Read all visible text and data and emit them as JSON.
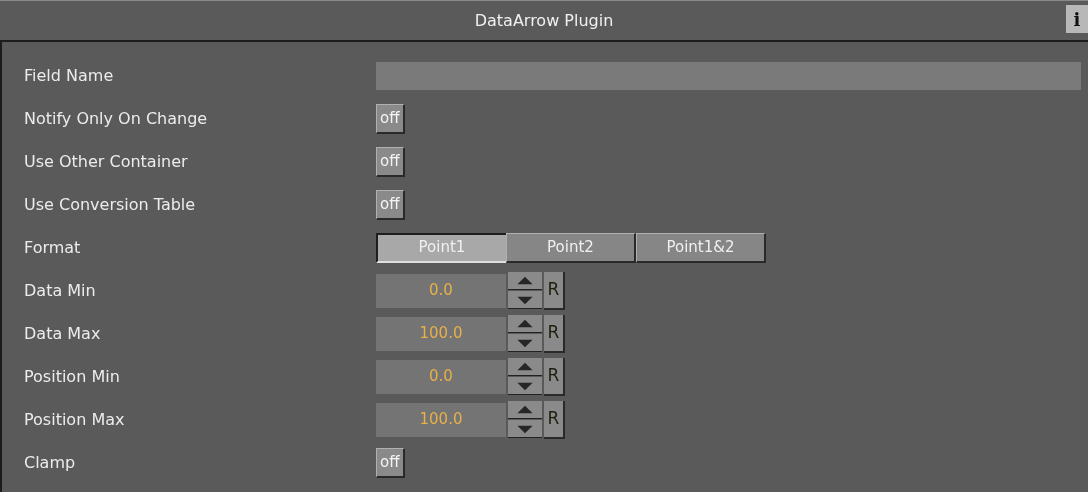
{
  "window": {
    "title": "DataArrow Plugin",
    "info_button": "i"
  },
  "rows": [
    {
      "kind": "field",
      "label": "Field Name"
    },
    {
      "kind": "toggle",
      "label": "Notify Only On Change",
      "value": "off"
    },
    {
      "kind": "toggle",
      "label": "Use Other Container",
      "value": "off"
    },
    {
      "kind": "toggle",
      "label": "Use Conversion Table",
      "value": "off"
    },
    {
      "kind": "segmented",
      "label": "Format",
      "options": [
        {
          "label": "Point1",
          "selected": true
        },
        {
          "label": "Point2",
          "selected": false
        },
        {
          "label": "Point1&2",
          "selected": false
        }
      ]
    },
    {
      "kind": "number",
      "label": "Data Min",
      "value": "0.0",
      "reset": "R"
    },
    {
      "kind": "number",
      "label": "Data Max",
      "value": "100.0",
      "reset": "R"
    },
    {
      "kind": "number",
      "label": "Position Min",
      "value": "0.0",
      "reset": "R"
    },
    {
      "kind": "number",
      "label": "Position Max",
      "value": "100.0",
      "reset": "R"
    },
    {
      "kind": "toggle",
      "label": "Clamp",
      "value": "off"
    }
  ]
}
